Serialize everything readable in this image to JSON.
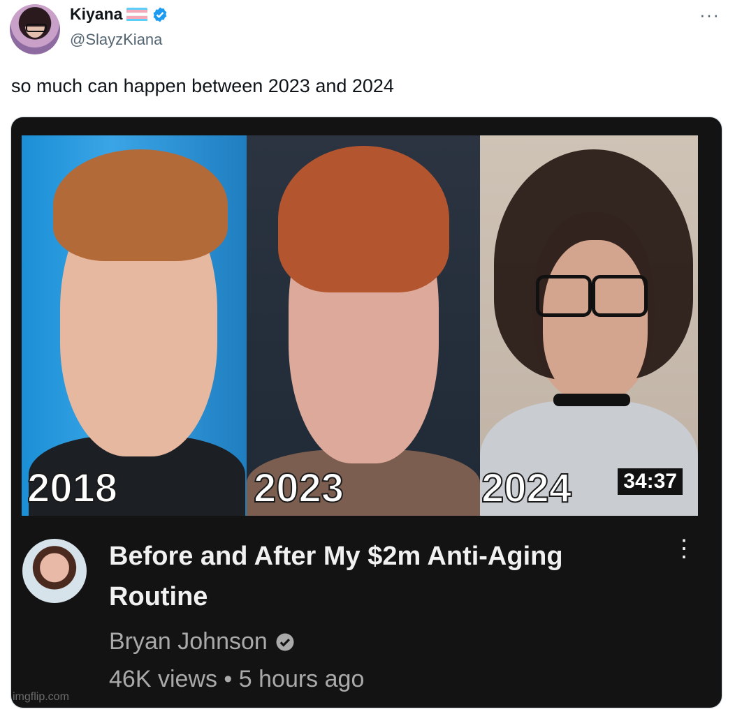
{
  "tweet": {
    "author_name": "Kiyana",
    "handle": "@SlayzKiana",
    "more_label": "···",
    "text": "so much can happen between 2023 and 2024",
    "flag_colors": [
      "#5bcefa",
      "#f5a9b8",
      "#ffffff",
      "#f5a9b8",
      "#5bcefa"
    ],
    "verified_color": "#1d9bf0"
  },
  "video": {
    "panels": [
      {
        "year": "2018"
      },
      {
        "year": "2023"
      },
      {
        "year": "2024"
      }
    ],
    "duration": "34:37",
    "title": "Before and After My $2m Anti-Aging Routine",
    "channel": "Bryan Johnson",
    "views": "46K views",
    "separator": "•",
    "age": "5 hours ago",
    "menu_label": "⋮",
    "watermark": "imgflip.com"
  }
}
